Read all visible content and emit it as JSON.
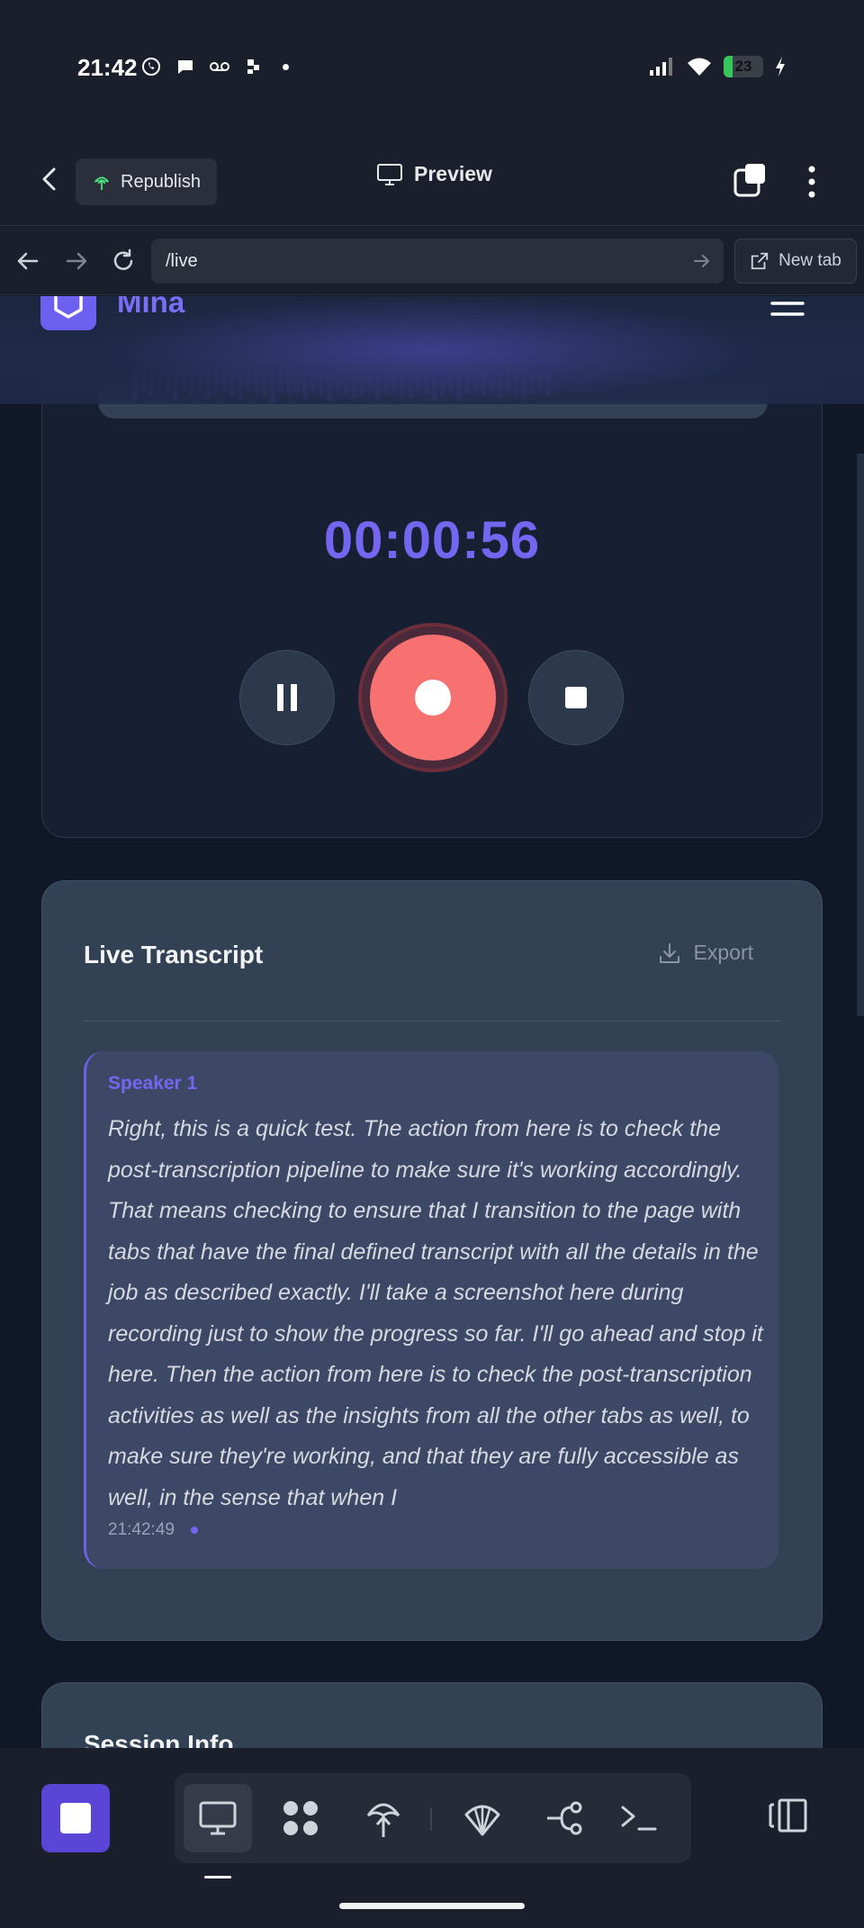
{
  "status_bar": {
    "time": "21:42",
    "battery": "23",
    "battery_level": 0.23
  },
  "app_header": {
    "republish_label": "Republish",
    "preview_label": "Preview"
  },
  "url_bar": {
    "url": "/live",
    "new_tab_label": "New tab"
  },
  "site_nav": {
    "brand": "Mina"
  },
  "recorder": {
    "elapsed": "00:00:56"
  },
  "transcript": {
    "title": "Live Transcript",
    "export_label": "Export",
    "segments": [
      {
        "speaker": "Speaker 1",
        "text": "Right, this is a quick test. The action from here is to check the post-transcription pipeline to make sure it's working accordingly. That means checking to ensure that I transition to the page with tabs that have the final defined transcript with all the details in the job as described exactly. I'll take a screenshot here during recording just to show the progress so far. I'll go ahead and stop it here. Then the action from here is to check the post-transcription activities as well as the insights from all the other tabs as well, to make sure they're working, and that they are fully accessible as well, in the sense that when I",
        "time": "21:42:49"
      }
    ]
  },
  "session_info": {
    "title": "Session Info"
  },
  "colors": {
    "accent": "#7466f0",
    "record": "#f87171",
    "card": "#334155",
    "background": "#101828"
  },
  "toolbar_icons": [
    "stop-square-icon",
    "desktop-icon",
    "components-icon",
    "deploy-icon",
    "shell-icon",
    "branch-icon",
    "terminal-icon",
    "side-panel-icon"
  ]
}
